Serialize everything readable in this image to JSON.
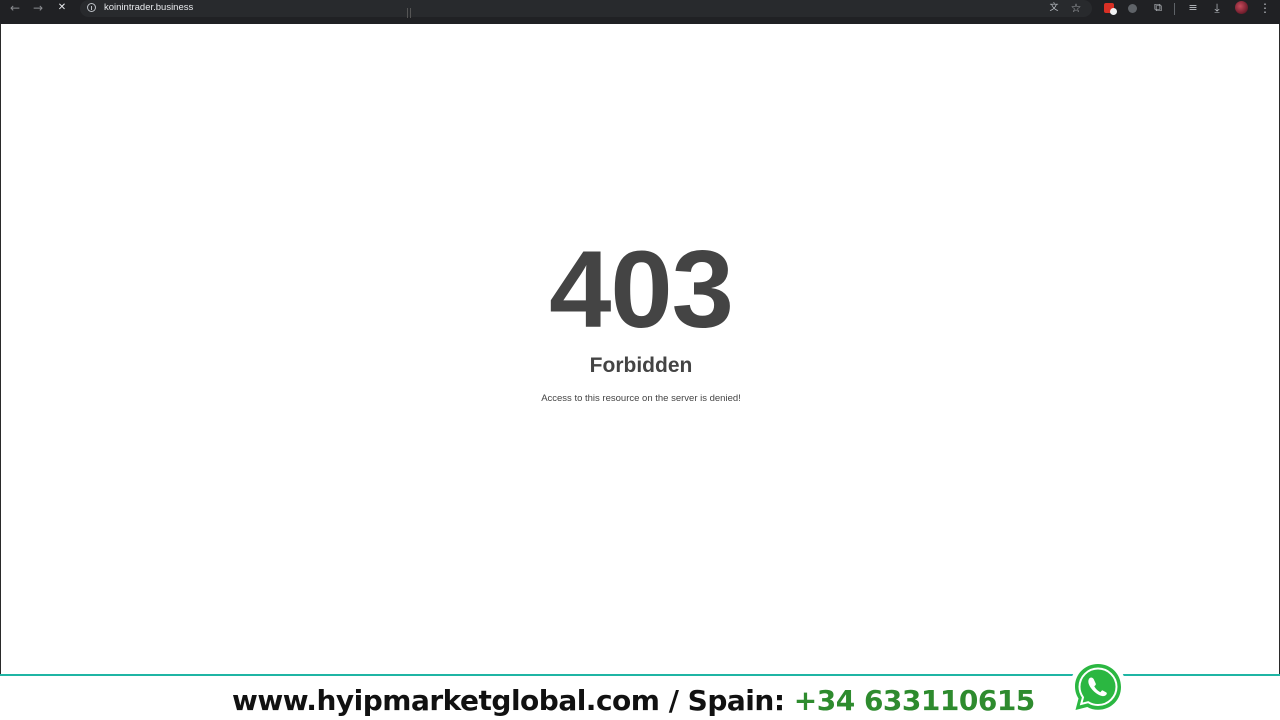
{
  "browser": {
    "url": "koinintrader.business",
    "icons": {
      "back": "←",
      "forward": "→",
      "stop": "✕",
      "translate": "文",
      "bookmark": "☆",
      "extensions": "⧉",
      "reading_list": "≡",
      "download": "⤓",
      "menu": "⋮"
    }
  },
  "page": {
    "error_code": "403",
    "error_title": "Forbidden",
    "error_description": "Access to this resource on the server is denied!"
  },
  "banner": {
    "site_text": "www.hyipmarketglobal.com / Spain: ",
    "phone": "+34 633110615",
    "accent_color": "#2e8b2e",
    "line_color": "#1fb5a4"
  }
}
